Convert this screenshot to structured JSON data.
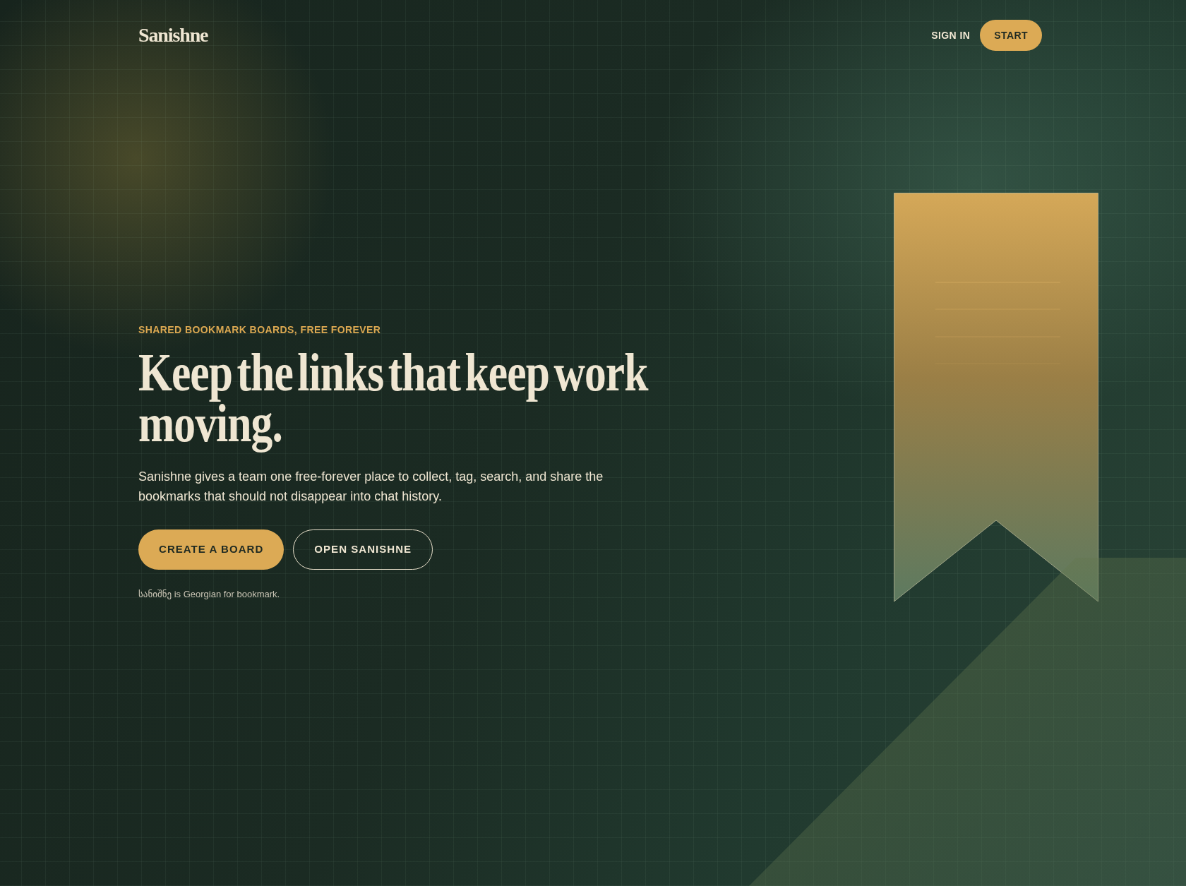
{
  "header": {
    "logo": "Sanishne",
    "nav": [
      {
        "label": "SIGN IN",
        "kind": "link"
      },
      {
        "label": "START",
        "kind": "button"
      }
    ]
  },
  "hero": {
    "eyebrow": "SHARED BOOKMARK BOARDS, FREE FOREVER",
    "headline": "Keep the links that keep work moving.",
    "description": "Sanishne gives a team one free-forever place to collect, tag, search, and share the bookmarks that should not disappear into chat history.",
    "actions": [
      {
        "label": "CREATE A BOARD",
        "kind": "primary"
      },
      {
        "label": "OPEN SANISHNE",
        "kind": "secondary"
      }
    ],
    "footnote": "სანიშნე is Georgian for bookmark."
  }
}
